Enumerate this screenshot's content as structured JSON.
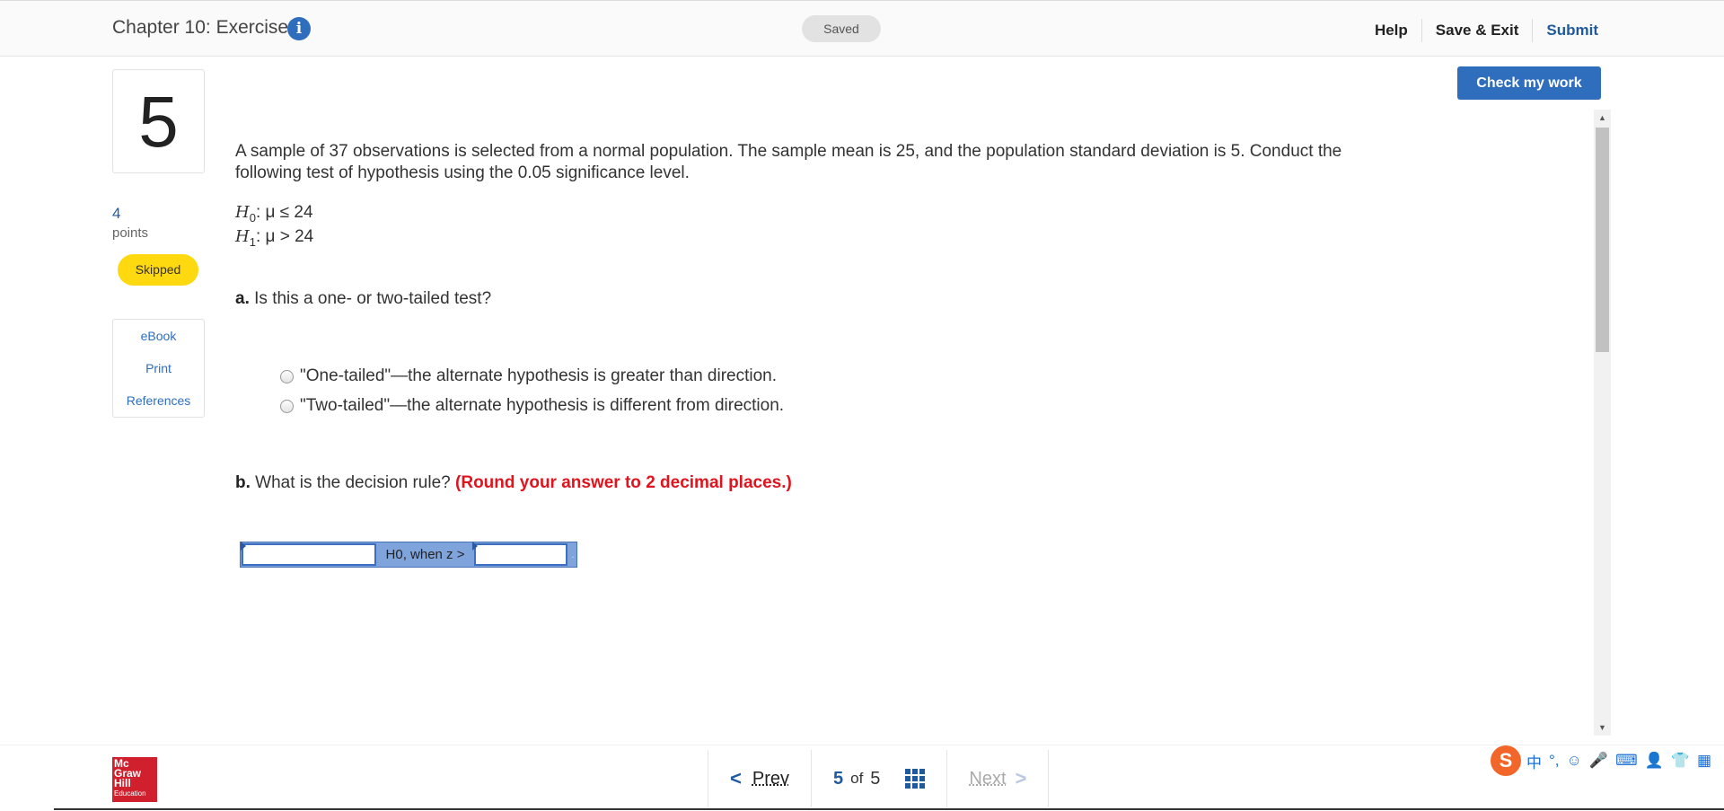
{
  "header": {
    "title": "Chapter 10: Exercises",
    "info_icon": "i",
    "saved": "Saved",
    "help": "Help",
    "save_exit": "Save & Exit",
    "submit": "Submit"
  },
  "sidebar": {
    "question_number": "5",
    "points_value": "4",
    "points_label": "points",
    "status": "Skipped",
    "links": [
      "eBook",
      "Print",
      "References"
    ]
  },
  "check_my_work": "Check my work",
  "question": {
    "text": "A sample of 37 observations is selected from a normal population. The sample mean is 25, and the population standard deviation is 5. Conduct the following test of hypothesis using the 0.05 significance level.",
    "h0": {
      "symbol": "H",
      "sub": "0",
      "rest": ": μ ≤ 24"
    },
    "h1": {
      "symbol": "H",
      "sub": "1",
      "rest": ": μ > 24"
    },
    "part_a": {
      "letter": "a.",
      "text": "Is this a one- or two-tailed test?"
    },
    "options": [
      "\"One-tailed\"—the alternate hypothesis is greater than direction.",
      "\"Two-tailed\"—the alternate hypothesis is different from direction."
    ],
    "part_b": {
      "letter": "b.",
      "text": "What is the decision rule?",
      "hint": "(Round your answer to 2 decimal places.)"
    },
    "rule": {
      "field1_value": "",
      "middle": "H0, when z >",
      "field2_value": "",
      "end": "."
    }
  },
  "footer": {
    "logo": [
      "Mc",
      "Graw",
      "Hill",
      "Education"
    ],
    "prev": "Prev",
    "current": "5",
    "of": "of",
    "total": "5",
    "next": "Next"
  },
  "ime": {
    "items": [
      "中",
      "°,",
      "☺",
      "🎤",
      "⌨",
      "👤",
      "👕",
      "▦"
    ]
  }
}
